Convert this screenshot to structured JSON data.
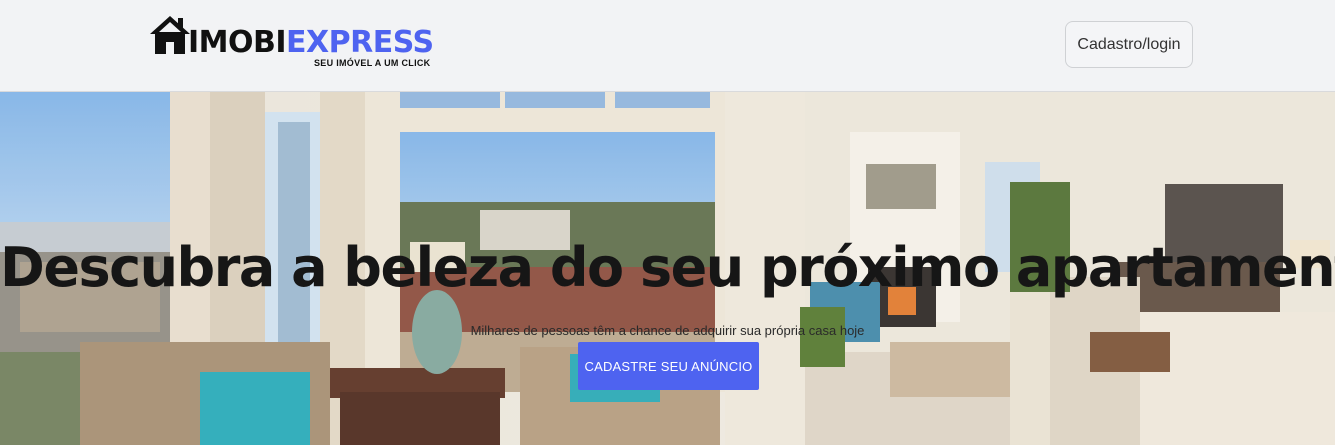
{
  "header": {
    "logo": {
      "word_part1": "IMOBI",
      "word_part2": "EXPRESS",
      "tagline": "SEU IMÓVEL A UM  CLICK",
      "icon": "house-icon"
    },
    "login_button": "Cadastro/login"
  },
  "hero": {
    "background": "living-room-photo",
    "title": "Descubra a beleza do seu próximo apartamento",
    "subtitle": "Milhares de pessoas têm a chance de adquirir sua própria casa hoje",
    "cta_button": "CADASTRE SEU ANÚNCIO"
  },
  "colors": {
    "accent": "#4e63f0",
    "header_bg": "#f2f3f5",
    "title_text": "#161616"
  }
}
